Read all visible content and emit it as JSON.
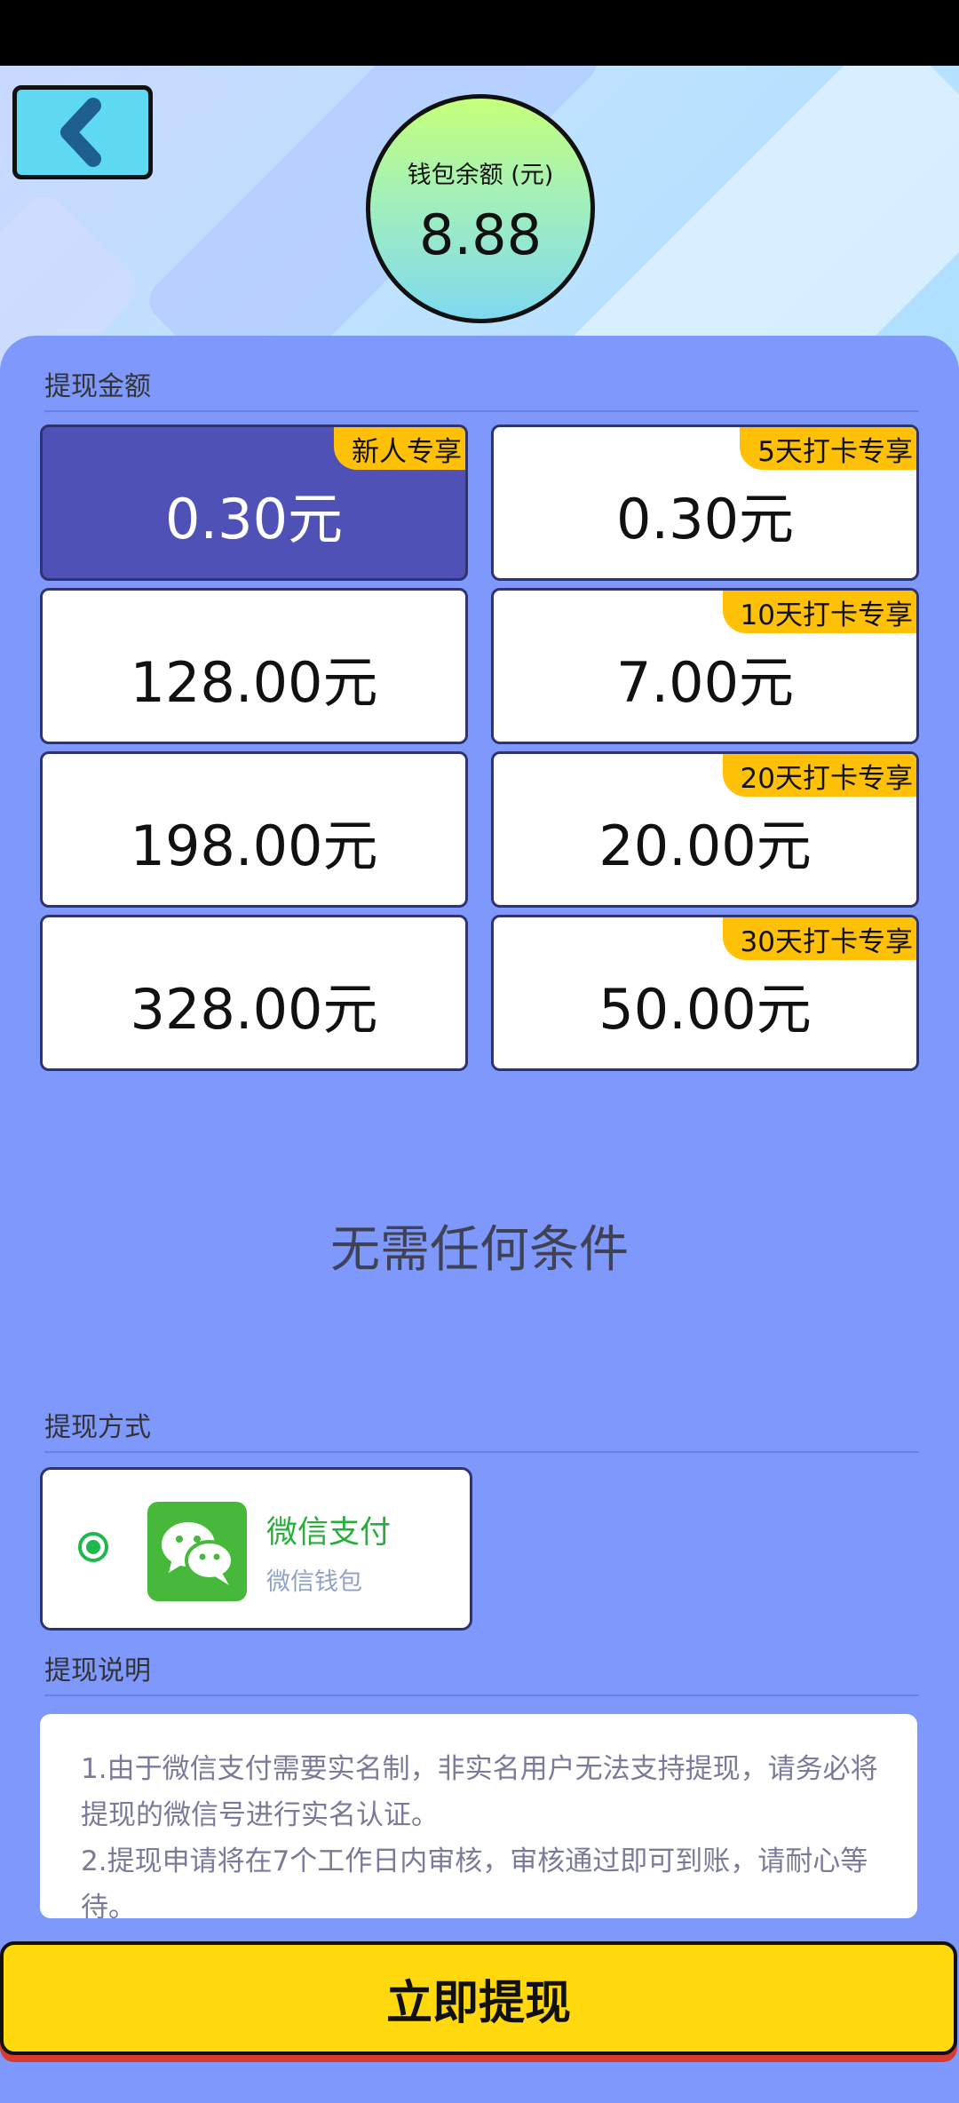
{
  "balance": {
    "label": "钱包余额 (元)",
    "value": "8.88"
  },
  "sections": {
    "amount_title": "提现金额",
    "method_title": "提现方式",
    "notes_title": "提现说明"
  },
  "amounts": [
    {
      "label": "0.30元",
      "badge": "新人专享",
      "selected": true
    },
    {
      "label": "0.30元",
      "badge": "5天打卡专享"
    },
    {
      "label": "128.00元"
    },
    {
      "label": "7.00元",
      "badge": "10天打卡专享"
    },
    {
      "label": "198.00元"
    },
    {
      "label": "20.00元",
      "badge": "20天打卡专享"
    },
    {
      "label": "328.00元"
    },
    {
      "label": "50.00元",
      "badge": "30天打卡专享"
    }
  ],
  "condition": "无需任何条件",
  "method": {
    "name": "微信支付",
    "sub": "微信钱包"
  },
  "notes": [
    "1.由于微信支付需要实名制，非实名用户无法支持提现，请务必将提现的微信号进行实名认证。",
    "2.提现申请将在7个工作日内审核，审核通过即可到账，请耐心等待。"
  ],
  "withdraw_button": "立即提现",
  "colors": {
    "accent_yellow": "#ffd90e",
    "badge": "#ffc107",
    "selected_card": "#4f51b6",
    "panel": "#7e98fc",
    "wechat_green": "#47b93a"
  },
  "icons": {
    "back": "chevron-left-icon",
    "wechat": "wechat-icon",
    "radio": "radio-selected-icon"
  }
}
